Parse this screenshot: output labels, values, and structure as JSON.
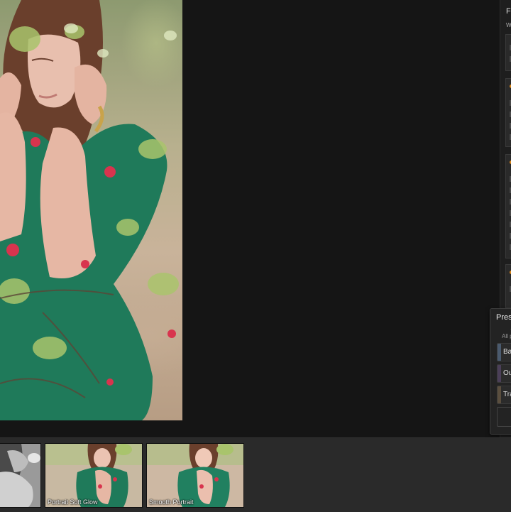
{
  "side_panel": {
    "title": "Fi",
    "subtitle": "W"
  },
  "presets": {
    "title": "Pres",
    "filter_caret": "⌄",
    "filter_label": "All p",
    "items": [
      {
        "label": "Ba",
        "thumb_color": "#4a5a6e"
      },
      {
        "label": "Ou",
        "thumb_color": "#4b3f58"
      },
      {
        "label": "Tra",
        "thumb_color": "#5a4e3e"
      }
    ]
  },
  "accent_color": "#e08a1c",
  "filmstrip": {
    "items": [
      {
        "label": "",
        "style": "black-and-white"
      },
      {
        "label": "Portrait Soft Glow",
        "style": "color"
      },
      {
        "label": "Smooth Portrait",
        "style": "color"
      }
    ]
  }
}
